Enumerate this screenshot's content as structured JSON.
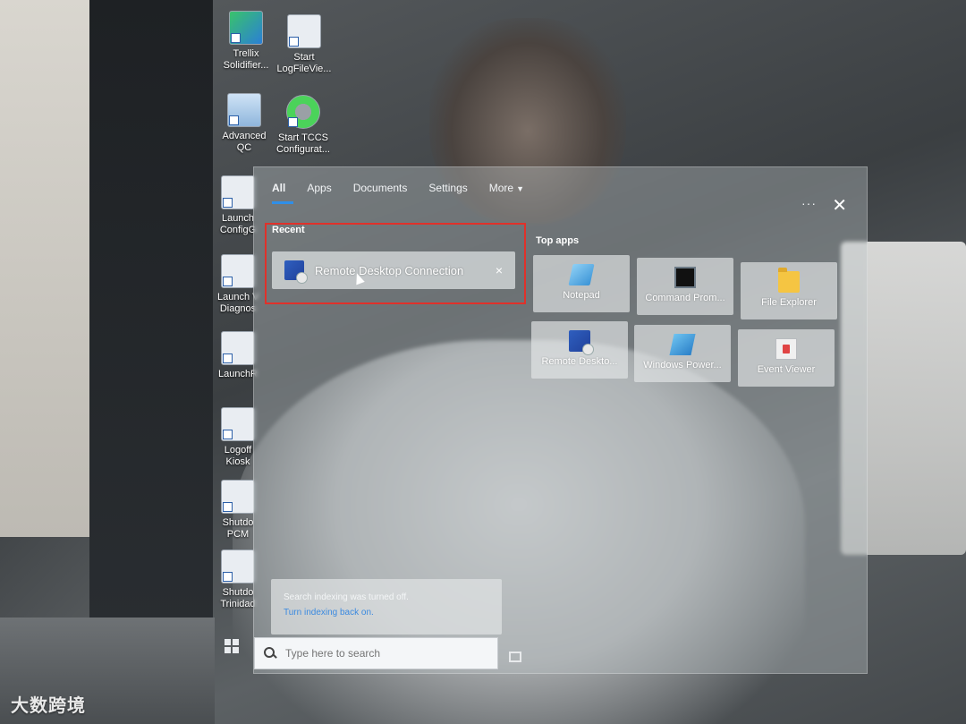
{
  "watermark": "大数跨境",
  "desktop_icons": [
    {
      "line1": "Trellix",
      "line2": "Solidifier..."
    },
    {
      "line1": "Start",
      "line2": "LogFileVie..."
    },
    {
      "line1": "Advanced",
      "line2": "QC"
    },
    {
      "line1": "Start TCCS",
      "line2": "Configurat..."
    },
    {
      "line1": "Launch",
      "line2": "ConfigG"
    },
    {
      "line1": "Launch V",
      "line2": "Diagnos"
    },
    {
      "line1": "LaunchR",
      "line2": ""
    },
    {
      "line1": "Logoff",
      "line2": "Kiosk"
    },
    {
      "line1": "Shutdo",
      "line2": "PCM"
    },
    {
      "line1": "Shutdo",
      "line2": "Trinidad"
    }
  ],
  "start_panel": {
    "tabs": [
      {
        "label": "All",
        "active": true
      },
      {
        "label": "Apps"
      },
      {
        "label": "Documents"
      },
      {
        "label": "Settings"
      },
      {
        "label": "More"
      }
    ],
    "dots": "···",
    "close": "✕",
    "recent_label": "Recent",
    "recent_items": [
      {
        "label": "Remote Desktop Connection",
        "icon": "remote-desktop-icon",
        "remove": "×"
      }
    ],
    "top_apps_label": "Top apps",
    "top_apps": [
      {
        "label": "Notepad",
        "icon": "notepad-icon"
      },
      {
        "label": "Command Prom...",
        "icon": "command-prompt-icon"
      },
      {
        "label": "File Explorer",
        "icon": "file-explorer-icon"
      },
      {
        "label": "Remote Deskto...",
        "icon": "remote-desktop-icon"
      },
      {
        "label": "Windows Power...",
        "icon": "powershell-icon"
      },
      {
        "label": "Event Viewer",
        "icon": "event-viewer-icon"
      }
    ],
    "notice": {
      "message": "Search indexing was turned off.",
      "link": "Turn indexing back on."
    }
  },
  "taskbar": {
    "search_placeholder": "Type here to search"
  },
  "colors": {
    "accent": "#2f8fe8",
    "highlight_border": "#e0312a",
    "link": "#3b8ae0"
  }
}
